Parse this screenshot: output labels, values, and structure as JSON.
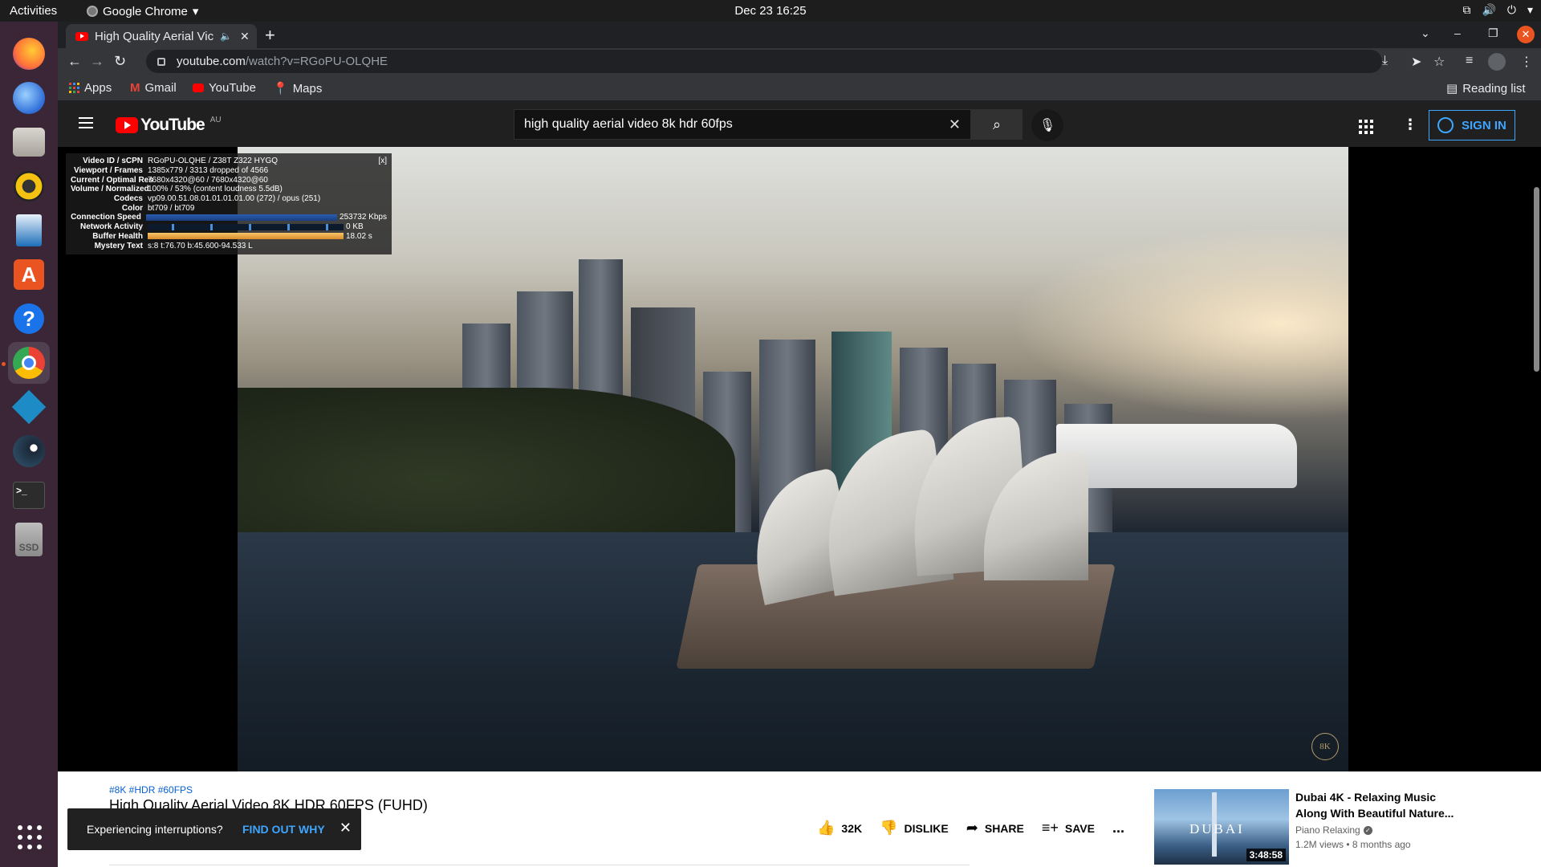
{
  "system": {
    "activities": "Activities",
    "app_name": "Google Chrome",
    "clock": "Dec 23  16:25"
  },
  "dock": {
    "items": [
      {
        "name": "firefox",
        "color": "#ff7139",
        "glyph": "🦊"
      },
      {
        "name": "thunderbird",
        "color": "#2f6ed8",
        "glyph": "✉"
      },
      {
        "name": "files",
        "color": "#aeaba5",
        "glyph": "▬"
      },
      {
        "name": "rhythmbox",
        "color": "#f5c211",
        "glyph": "◉"
      },
      {
        "name": "libreoffice-writer",
        "color": "#1d6eb8",
        "glyph": "≡"
      },
      {
        "name": "software-center",
        "color": "#e95420",
        "glyph": "A"
      },
      {
        "name": "help",
        "color": "#1a73e8",
        "glyph": "?"
      },
      {
        "name": "chrome",
        "color": "#ffffff",
        "glyph": "◎"
      },
      {
        "name": "kodi",
        "color": "#1c8bc6",
        "glyph": "◆"
      },
      {
        "name": "steam",
        "color": "#1b2838",
        "glyph": "⚙"
      },
      {
        "name": "terminal",
        "color": "#2c2c2c",
        "glyph": ">_"
      },
      {
        "name": "ssd-drive",
        "color": "#8a8a8a",
        "glyph": "SSD"
      }
    ]
  },
  "browser": {
    "tab_title": "High Quality Aerial Vic",
    "url_host": "youtube.com",
    "url_path": "/watch?v=RGoPU-OLQHE",
    "bookmarks": [
      {
        "label": "Apps"
      },
      {
        "label": "Gmail"
      },
      {
        "label": "YouTube"
      },
      {
        "label": "Maps"
      }
    ],
    "reading_list": "Reading list"
  },
  "youtube": {
    "logo_text": "YouTube",
    "region": "AU",
    "search_query": "high quality aerial video 8k hdr 60fps",
    "sign_in": "SIGN IN",
    "stats": {
      "close": "[x]",
      "rows": [
        {
          "label": "Video ID / sCPN",
          "value": "RGoPU-OLQHE / Z38T Z322 HYGQ"
        },
        {
          "label": "Viewport / Frames",
          "value": "1385x779 / 3313 dropped of 4566"
        },
        {
          "label": "Current / Optimal Res",
          "value": "7680x4320@60 / 7680x4320@60"
        },
        {
          "label": "Volume / Normalized",
          "value": "100% / 53% (content loudness 5.5dB)"
        },
        {
          "label": "Codecs",
          "value": "vp09.00.51.08.01.01.01.01.00 (272) / opus (251)"
        },
        {
          "label": "Color",
          "value": "bt709 / bt709"
        }
      ],
      "connection_speed_label": "Connection Speed",
      "connection_speed_value": "253732 Kbps",
      "network_activity_label": "Network Activity",
      "network_activity_value": "0 KB",
      "buffer_health_label": "Buffer Health",
      "buffer_health_value": "18.02 s",
      "mystery_label": "Mystery Text",
      "mystery_value": "s:8 t:76.70 b:45.600-94.533 L"
    },
    "watermark": "8K",
    "video": {
      "hashtags": "#8K #HDR #60FPS",
      "title": "High Quality Aerial Video 8K HDR 60FPS (FUHD)",
      "likes": "32K",
      "dislike": "DISLIKE",
      "share": "SHARE",
      "save": "SAVE",
      "more": "..."
    },
    "recommendation": {
      "title": "Dubai 4K - Relaxing Music Along With Beautiful Nature...",
      "channel": "Piano Relaxing",
      "meta": "1.2M views • 8 months ago",
      "duration": "3:48:58",
      "thumb_text": "DUBAI"
    },
    "toast": {
      "message": "Experiencing interruptions?",
      "action": "FIND OUT WHY"
    }
  }
}
